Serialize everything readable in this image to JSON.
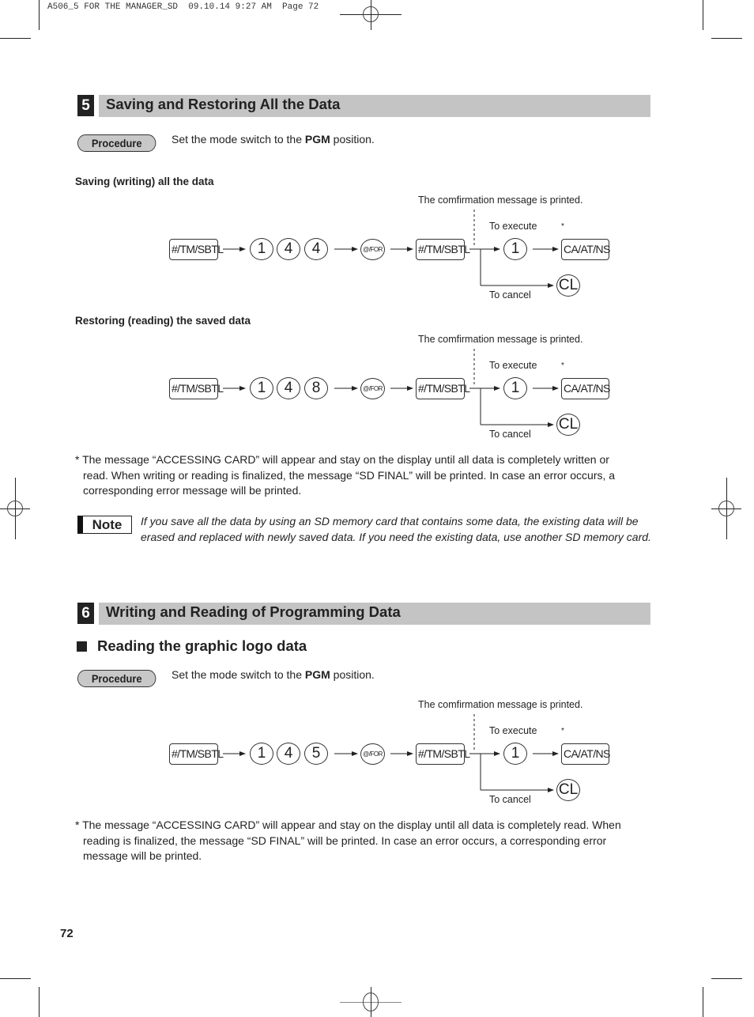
{
  "print_header": "A506_5 FOR THE MANAGER_SD  09.10.14 9:27 AM  Page 72",
  "section5": {
    "number": "5",
    "title": "Saving and Restoring All the Data",
    "procedure_label": "Procedure",
    "procedure_text_pre": "Set the mode switch to the ",
    "procedure_text_bold": "PGM",
    "procedure_text_post": " position.",
    "saving": {
      "heading": "Saving (writing) all the data",
      "confirm_msg": "The comfirmation message is printed.",
      "keys": {
        "k1": "#/TM/SBTL",
        "d1": "1",
        "d2": "4",
        "d3": "4",
        "for": "@/FOR",
        "k2": "#/TM/SBTL",
        "exec": "1",
        "final": "CA/AT/NS",
        "cl": "CL"
      },
      "to_execute": "To execute",
      "to_cancel": "To cancel",
      "asterisk": "*"
    },
    "restoring": {
      "heading": "Restoring (reading) the saved data",
      "confirm_msg": "The comfirmation message is printed.",
      "keys": {
        "k1": "#/TM/SBTL",
        "d1": "1",
        "d2": "4",
        "d3": "8",
        "for": "@/FOR",
        "k2": "#/TM/SBTL",
        "exec": "1",
        "final": "CA/AT/NS",
        "cl": "CL"
      },
      "to_execute": "To execute",
      "to_cancel": "To cancel",
      "asterisk": "*"
    },
    "footnote_line1": "* The message “ACCESSING CARD” will appear and stay on the display until all data is completely written or",
    "footnote_line2": "read. When writing or reading is finalized, the message “SD FINAL” will be printed. In case an error occurs, a",
    "footnote_line3": "corresponding error message will be printed.",
    "note_label": "Note",
    "note_text": "If you save all the data by using an SD memory card that contains some data, the existing data will be erased and replaced with newly saved data. If you need the existing data, use another SD memory card."
  },
  "section6": {
    "number": "6",
    "title": "Writing and Reading of Programming Data",
    "subheading": "Reading the graphic logo data",
    "procedure_label": "Procedure",
    "procedure_text_pre": "Set the mode switch to the ",
    "procedure_text_bold": "PGM",
    "procedure_text_post": " position.",
    "logo": {
      "confirm_msg": "The comfirmation message is printed.",
      "keys": {
        "k1": "#/TM/SBTL",
        "d1": "1",
        "d2": "4",
        "d3": "5",
        "for": "@/FOR",
        "k2": "#/TM/SBTL",
        "exec": "1",
        "final": "CA/AT/NS",
        "cl": "CL"
      },
      "to_execute": "To execute",
      "to_cancel": "To cancel",
      "asterisk": "*"
    },
    "footnote_line1": "* The message “ACCESSING CARD” will appear and stay on the display until all data is completely read. When",
    "footnote_line2": "reading is finalized, the message “SD FINAL” will be printed. In case an error occurs, a corresponding error",
    "footnote_line3": "message will be printed."
  },
  "page_number": "72"
}
